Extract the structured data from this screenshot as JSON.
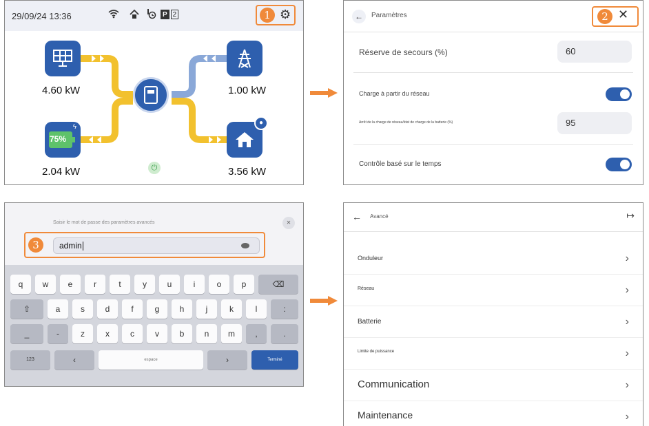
{
  "dashboard": {
    "datetime": "29/09/24 13:36",
    "status_icons": [
      "wifi-icon",
      "home-signal-icon",
      "timer-icon"
    ],
    "preset_badge": [
      "P",
      "2"
    ],
    "callout": "1",
    "solar_power": "4.60 kW",
    "grid_power": "1.00 kW",
    "battery_power": "2.04 kW",
    "battery_soc": "75%",
    "home_power": "3.56 kW",
    "colors": {
      "tile_blue": "#2e5fae",
      "battery_green": "#3e8f4f",
      "solar_flow": "#f2c12e",
      "grid_flow": "#8aa8d8",
      "highlight": "#f08a3a"
    }
  },
  "settings": {
    "title": "Paramètres",
    "callout": "2",
    "backup_reserve_label": "Réserve de secours (%)",
    "backup_reserve_value": "60",
    "grid_charge_label": "Charge à partir du réseau",
    "stop_charge_label": "Arrêt de la charge de réseau/état de charge de la batterie (%)",
    "stop_charge_value": "95",
    "time_control_label": "Contrôle basé sur le temps"
  },
  "login": {
    "prompt": "Saisir le mot de passe des paramètres avancés",
    "callout": "3",
    "password_value": "admin",
    "keyboard_rows": [
      [
        "q",
        "w",
        "e",
        "r",
        "t",
        "y",
        "u",
        "i",
        "o",
        "p",
        "⌫"
      ],
      [
        "⇧",
        "a",
        "s",
        "d",
        "f",
        "g",
        "h",
        "j",
        "k",
        "l",
        ":"
      ],
      [
        "_",
        "-",
        "z",
        "x",
        "c",
        "v",
        "b",
        "n",
        "m",
        ",",
        "."
      ]
    ],
    "bottom_row": {
      "mode": "123",
      "left": "‹",
      "space": "espace",
      "right": "›",
      "submit": "Terminé"
    }
  },
  "advanced": {
    "title": "Avancé",
    "items": [
      "Onduleur",
      "Réseau",
      "Batterie",
      "Limite de puissance",
      "Communication",
      "Maintenance"
    ]
  }
}
